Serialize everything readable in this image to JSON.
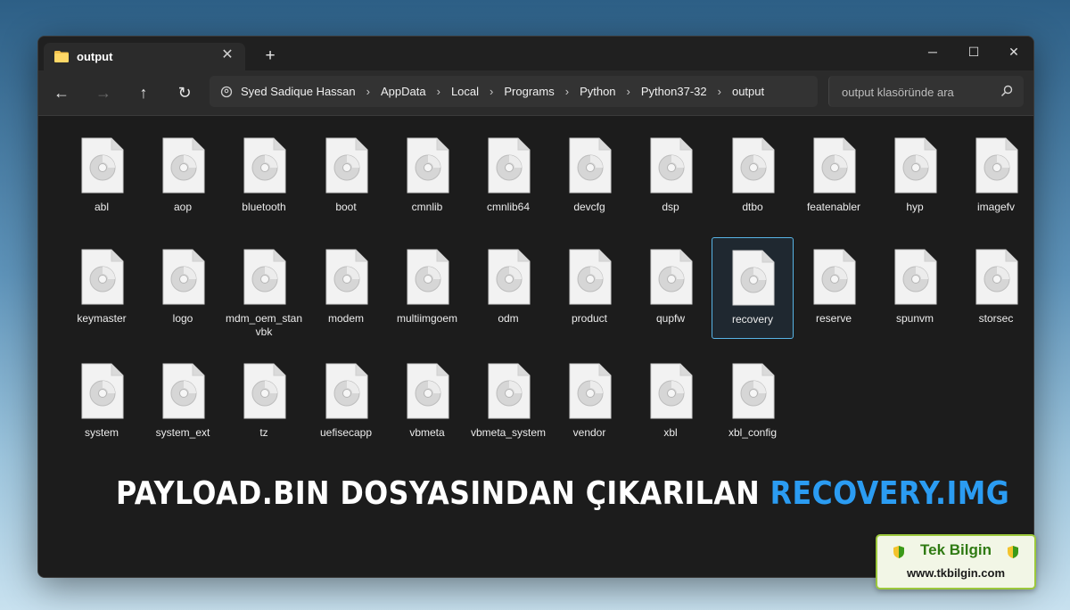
{
  "window": {
    "tab_title": "output",
    "new_tab": "+",
    "controls": {
      "minimize": "─",
      "maximize": "☐",
      "close": "✕"
    },
    "tab_close": "✕"
  },
  "toolbar": {
    "back": "←",
    "forward": "→",
    "up": "↑",
    "refresh": "↻",
    "breadcrumbs": [
      "Syed Sadique Hassan",
      "AppData",
      "Local",
      "Programs",
      "Python",
      "Python37-32",
      "output"
    ],
    "separator": "›",
    "search_placeholder": "output klasöründe ara"
  },
  "files": [
    {
      "name": "abl"
    },
    {
      "name": "aop"
    },
    {
      "name": "bluetooth"
    },
    {
      "name": "boot"
    },
    {
      "name": "cmnlib"
    },
    {
      "name": "cmnlib64"
    },
    {
      "name": "devcfg"
    },
    {
      "name": "dsp"
    },
    {
      "name": "dtbo"
    },
    {
      "name": "featenabler"
    },
    {
      "name": "hyp"
    },
    {
      "name": "imagefv"
    },
    {
      "name": "keymaster"
    },
    {
      "name": "logo"
    },
    {
      "name": "mdm_oem_stanvbk"
    },
    {
      "name": "modem"
    },
    {
      "name": "multiimgoem"
    },
    {
      "name": "odm"
    },
    {
      "name": "product"
    },
    {
      "name": "qupfw"
    },
    {
      "name": "recovery",
      "selected": true
    },
    {
      "name": "reserve"
    },
    {
      "name": "spunvm"
    },
    {
      "name": "storsec"
    },
    {
      "name": "system"
    },
    {
      "name": "system_ext"
    },
    {
      "name": "tz"
    },
    {
      "name": "uefisecapp"
    },
    {
      "name": "vbmeta"
    },
    {
      "name": "vbmeta_system"
    },
    {
      "name": "vendor"
    },
    {
      "name": "xbl"
    },
    {
      "name": "xbl_config"
    }
  ],
  "file_icon": "disc-image-file-icon",
  "headline": {
    "main": "PAYLOAD.BIN DOSYASINDAN ÇIKARILAN ",
    "accent": "RECOVERY.IMG",
    "accent_color": "#2b9cf2"
  },
  "brand": {
    "name": "Tek Bilgin",
    "url": "www.tkbilgin.com",
    "color": "#2f7a12"
  },
  "colors": {
    "window_bg": "#1c1c1c",
    "toolbar_bg": "#2b2b2b",
    "selection_border": "#58b4e6"
  }
}
